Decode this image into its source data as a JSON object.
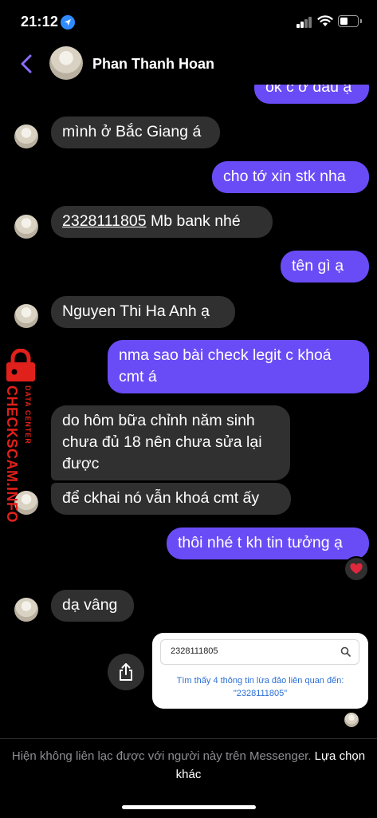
{
  "status": {
    "time": "21:12"
  },
  "header": {
    "contact_name": "Phan Thanh Hoan"
  },
  "messages": [
    {
      "dir": "out",
      "text": "ok c ở đâu ạ"
    },
    {
      "dir": "in",
      "text": "mình ở Bắc Giang á"
    },
    {
      "dir": "out",
      "text": "cho tớ xin stk nha"
    },
    {
      "dir": "in",
      "account": "2328111805",
      "text": " Mb bank nhé"
    },
    {
      "dir": "out",
      "text": "tên gì ạ"
    },
    {
      "dir": "in",
      "text": "Nguyen Thi Ha Anh ạ"
    },
    {
      "dir": "out",
      "text": "nma sao bài check legit c khoá cmt á"
    },
    {
      "dir": "in",
      "text": "do hôm bữa chỉnh năm sinh chưa đủ 18 nên chưa sửa lại được"
    },
    {
      "dir": "in",
      "text": "để ckhai nó vẫn khoá cmt ấy"
    },
    {
      "dir": "out",
      "text": "thôi nhé t kh tin tưởng ạ",
      "reaction": "heart"
    },
    {
      "dir": "in",
      "text": "dạ vâng"
    }
  ],
  "shared_image": {
    "search_value": "2328111805",
    "result_line1": "Tìm thấy 4 thông tin lừa đảo liên quan đến:",
    "result_line2": "\"2328111805\""
  },
  "footer": {
    "notice": "Hiện không liên lạc được với người này trên Messenger.",
    "link": "Lựa chọn khác"
  },
  "watermark": {
    "brand": "CHECKSCAM.INFO",
    "sub": "DATA CENTER"
  },
  "colors": {
    "outgoing": "#6a4cf6",
    "incoming": "#303030",
    "accent": "#8a6cff",
    "watermark": "#e0201b"
  }
}
